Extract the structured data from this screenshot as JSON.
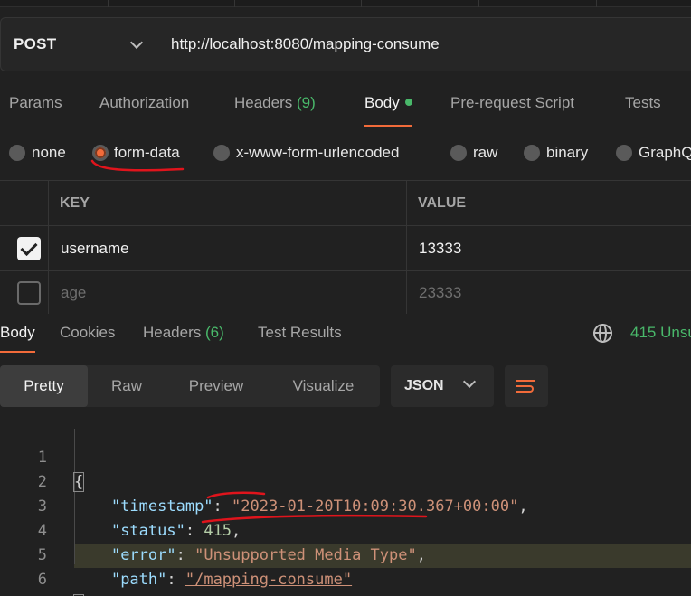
{
  "request": {
    "method": "POST",
    "url": "http://localhost:8080/mapping-consume"
  },
  "request_tabs": {
    "params": "Params",
    "authorization": "Authorization",
    "headers_label": "Headers",
    "headers_count": "(9)",
    "body": "Body",
    "pre_request": "Pre-request Script",
    "tests": "Tests"
  },
  "body_types": {
    "none": "none",
    "form_data": "form-data",
    "urlencoded": "x-www-form-urlencoded",
    "raw": "raw",
    "binary": "binary",
    "graphql": "GraphQ",
    "selected": "form-data"
  },
  "kv_table": {
    "key_header": "KEY",
    "value_header": "VALUE",
    "rows": [
      {
        "key": "username",
        "value": "13333",
        "checked": true
      },
      {
        "key": "age",
        "value": "23333",
        "checked": false
      }
    ]
  },
  "response_tabs": {
    "body": "Body",
    "cookies": "Cookies",
    "headers_label": "Headers",
    "headers_count": "(6)",
    "test_results": "Test Results",
    "status": "415 Unsu"
  },
  "view_modes": {
    "pretty": "Pretty",
    "raw": "Raw",
    "preview": "Preview",
    "visualize": "Visualize",
    "language": "JSON"
  },
  "response_body": {
    "line_numbers": [
      "1",
      "2",
      "3",
      "4",
      "5",
      "6"
    ],
    "open_brace": "{",
    "close_brace": "}",
    "timestamp_key": "\"timestamp\"",
    "timestamp_value": "\"2023-01-20T10:09:30.367+00:00\"",
    "status_key": "\"status\"",
    "status_value": "415",
    "error_key": "\"error\"",
    "error_value": "\"Unsupported Media Type\"",
    "path_key": "\"path\"",
    "path_value": "\"/mapping-consume\""
  },
  "colors": {
    "accent": "#f26b3a",
    "green": "#49b86a",
    "annotation_red": "#e0141c"
  },
  "icons": [
    "chevron-down-icon",
    "checkbox-icon",
    "globe-icon",
    "wrap-lines-icon"
  ]
}
